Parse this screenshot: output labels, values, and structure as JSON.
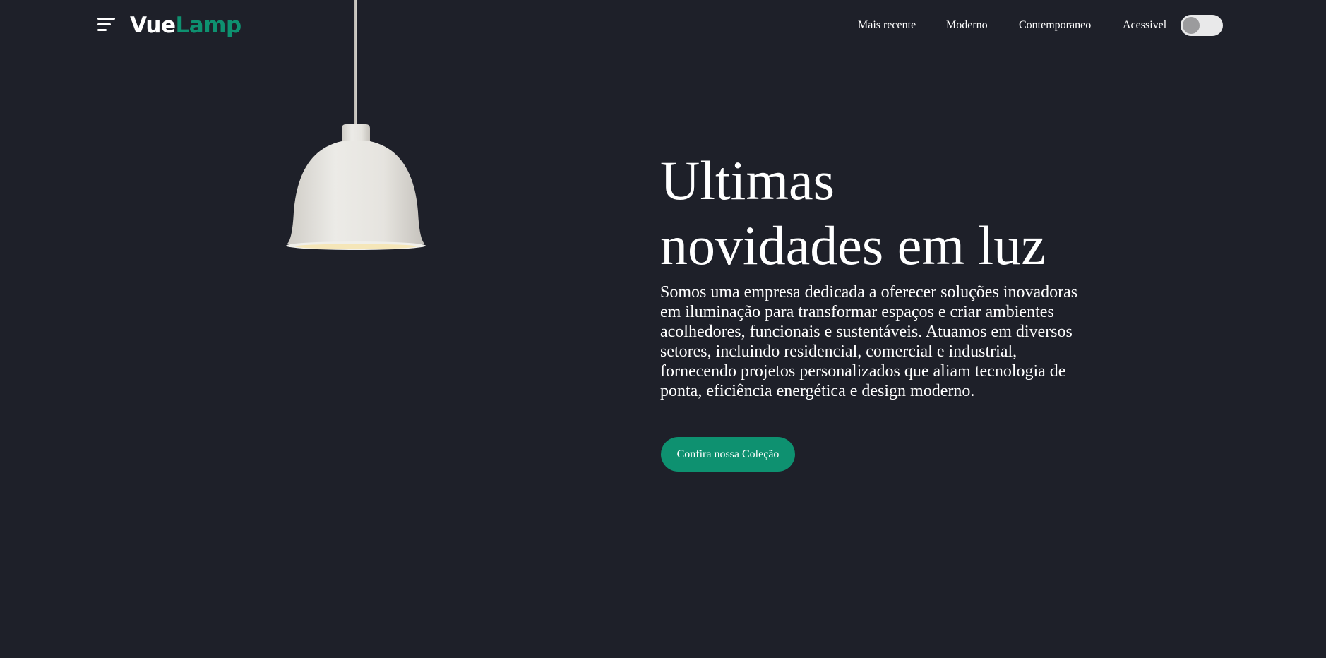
{
  "header": {
    "menu_icon": "hamburger-menu-icon",
    "logo": {
      "part1": "Vue",
      "part2": "Lamp",
      "part1_color": "#ffffff",
      "part2_color": "#0e9170"
    },
    "nav": [
      {
        "label": "Mais recente"
      },
      {
        "label": "Moderno"
      },
      {
        "label": "Contemporaneo"
      },
      {
        "label": "Acessivel"
      }
    ],
    "accessibility_toggle": {
      "on": false
    }
  },
  "hero": {
    "title_line1": "Ultimas",
    "title_line2": "novidades em luz",
    "description": "Somos uma empresa dedicada a oferecer soluções inovadoras em iluminação para transformar espaços e criar ambientes acolhedores, funcionais e sustentáveis. Atuamos em diversos setores, incluindo residencial, comercial e industrial, fornecendo projetos personalizados que aliam tecnologia de ponta, eficiência energética e design moderno.",
    "cta_label": "Confira nossa Coleção"
  },
  "colors": {
    "background": "#1e2029",
    "accent": "#0e9170",
    "text": "#ffffff"
  }
}
